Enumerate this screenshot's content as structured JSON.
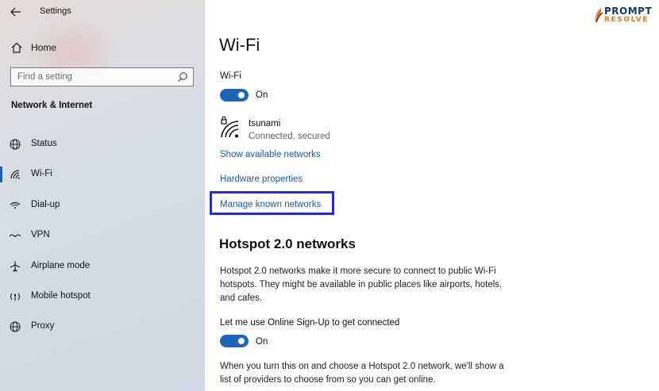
{
  "window": {
    "title": "Settings"
  },
  "sidebar": {
    "home_label": "Home",
    "search": {
      "placeholder": "Find a setting",
      "value": ""
    },
    "section_title": "Network & Internet",
    "items": [
      {
        "label": "Status",
        "icon": "globe-icon",
        "active": false
      },
      {
        "label": "Wi-Fi",
        "icon": "wifi-icon",
        "active": true
      },
      {
        "label": "Dial-up",
        "icon": "phone-icon",
        "active": false
      },
      {
        "label": "VPN",
        "icon": "vpn-icon",
        "active": false
      },
      {
        "label": "Airplane mode",
        "icon": "airplane-icon",
        "active": false
      },
      {
        "label": "Mobile hotspot",
        "icon": "hotspot-icon",
        "active": false
      },
      {
        "label": "Proxy",
        "icon": "globe-icon",
        "active": false
      }
    ]
  },
  "logo": {
    "line1": "PROMPT",
    "line2": "RESOLVE"
  },
  "main": {
    "title": "Wi-Fi",
    "wifi_label": "Wi-Fi",
    "wifi_toggle_text": "On",
    "network": {
      "name": "tsunami",
      "status": "Connected, secured"
    },
    "links": {
      "show_networks": "Show available networks",
      "hardware": "Hardware properties",
      "manage_known": "Manage known networks"
    },
    "hotspot": {
      "title": "Hotspot 2.0 networks",
      "desc_lines": [
        "Hotspot 2.0 networks make it more secure to connect to public Wi-Fi",
        "hotspots. They might be available in public places like airports, hotels,",
        "and cafes."
      ],
      "signup_label": "Let me use Online Sign-Up to get connected",
      "signup_toggle_text": "On",
      "bottom_lines": [
        "When you turn this on and choose a Hotspot 2.0 network, we'll show a",
        "list of providers to choose from so you can get online."
      ]
    }
  },
  "colors": {
    "accent": "#1e66b5",
    "link": "#1a5aa8",
    "highlight": "#2b2bd6"
  }
}
